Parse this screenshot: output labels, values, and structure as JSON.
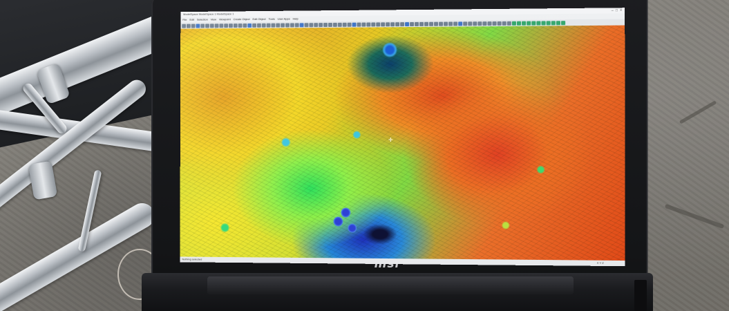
{
  "app": {
    "window_title": "ModelSpace ModelSpace 1 ModelSpace 1",
    "menu": [
      "File",
      "Edit",
      "Selection",
      "View",
      "Viewpoint",
      "Create Object",
      "Edit Object",
      "Tools",
      "User Apps",
      "Help"
    ],
    "window_controls": [
      "–",
      "□",
      "×"
    ],
    "status_text": "Nothing selected",
    "status_right": "X Y Z"
  },
  "laptop": {
    "brand": "msi"
  },
  "colors": {
    "bezel": "#141517",
    "heatmap": [
      "#1b2fb9",
      "#2486d8",
      "#2fe05c",
      "#f4d624",
      "#f08a22",
      "#e03a1a"
    ]
  },
  "icons": [
    "toolbar-button-icon",
    "cursor-icon"
  ]
}
